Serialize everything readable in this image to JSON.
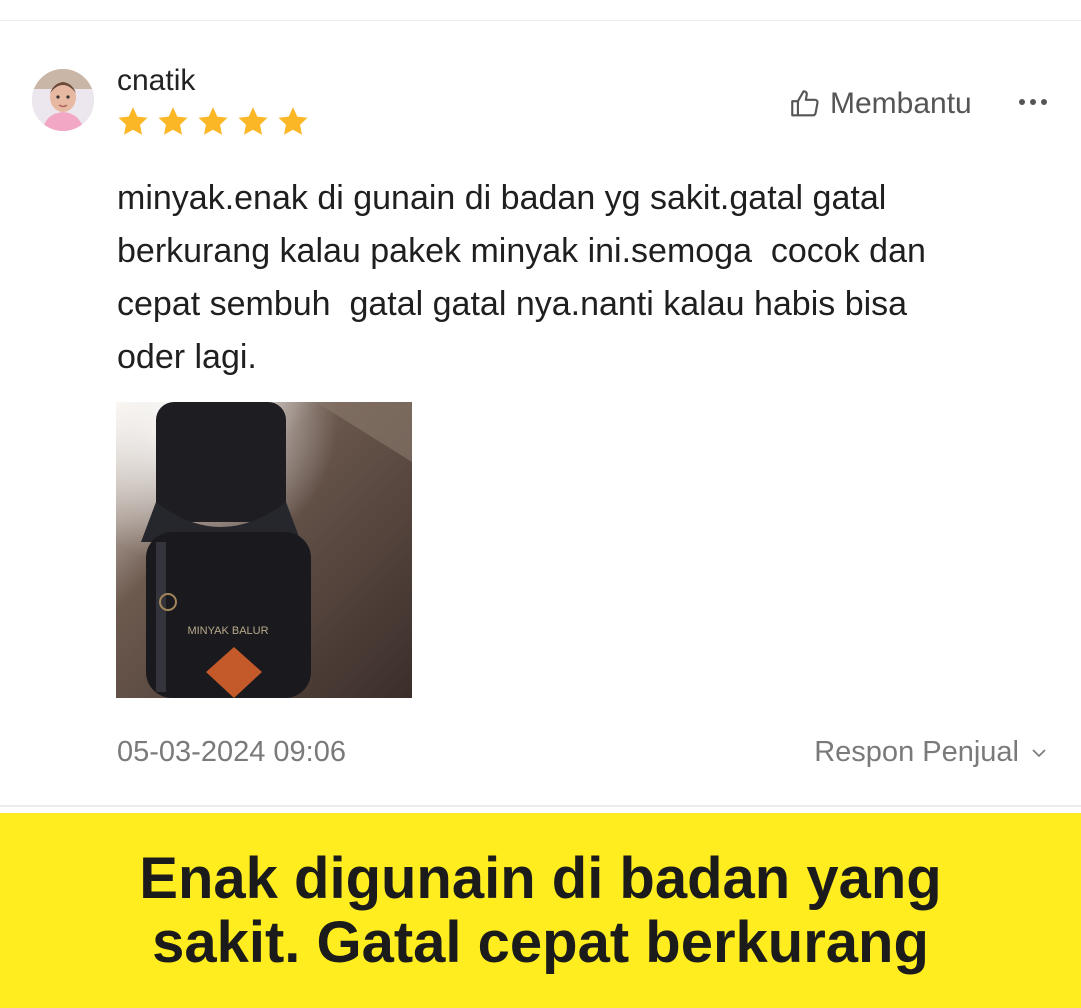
{
  "review": {
    "username": "cnatik",
    "rating": 5,
    "rating_max": 5,
    "helpful_label": "Membantu",
    "text": "minyak.enak di gunain di badan yg sakit.gatal gatal\nberkurang kalau pakek minyak ini.semoga  cocok dan\ncepat sembuh  gatal gatal nya.nanti kalau habis bisa\noder lagi.",
    "photo_label": "MINYAK BALUR",
    "date": "05-03-2024 09:06",
    "seller_response_label": "Respon Penjual"
  },
  "banner": {
    "text": "Enak digunain di badan yang\nsakit. Gatal cepat berkurang"
  },
  "icons": {
    "helpful": "thumbs-up-icon",
    "more": "more-horizontal-icon",
    "seller_response": "chevron-down-icon",
    "star": "star-icon"
  },
  "colors": {
    "star": "#fbb726",
    "banner_background": "#ffed1f",
    "meta_text": "#7a7a7a"
  }
}
